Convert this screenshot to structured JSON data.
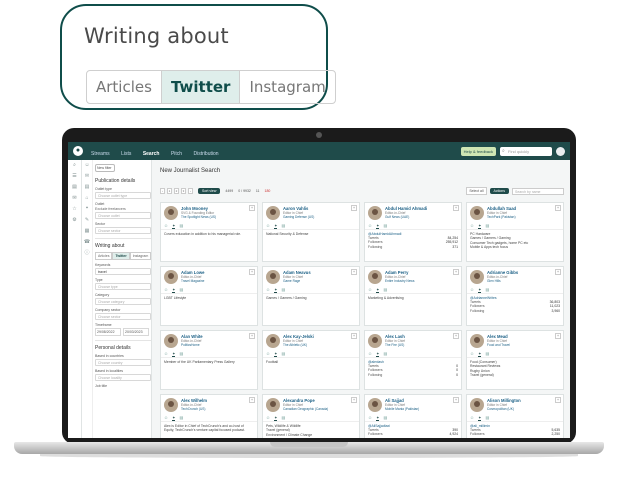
{
  "callout": {
    "title": "Writing about",
    "tabs": [
      {
        "label": "Articles",
        "active": false
      },
      {
        "label": "Twitter",
        "active": true
      },
      {
        "label": "Instagram",
        "active": false
      }
    ]
  },
  "app": {
    "nav": [
      "Streams",
      "Lists",
      "Search",
      "Pitch",
      "Distribution"
    ],
    "nav_active": "Search",
    "help_label": "Help & feedback",
    "search_placeholder": "Find quickly",
    "icon_strip": [
      "⌕",
      "☰",
      "▤",
      "✉",
      "☆",
      "⚙",
      "✎",
      "☎",
      "⓪",
      "ⓘ"
    ]
  },
  "filters": {
    "new_filter": "New filter",
    "publication_heading": "Publication details",
    "outlet_type_label": "Outlet type",
    "outlet_type_placeholder": "Choose outlet type",
    "outlet_label": "Outlet",
    "outlet_exclude": "Exclude freelancers",
    "outlet_placeholder": "Choose outlet",
    "sector_label": "Sector",
    "sector_placeholder": "Choose sector",
    "writing_heading": "Writing about",
    "writing_tabs": [
      "Articles",
      "Twitter",
      "Instagram"
    ],
    "keywords_label": "Keywords",
    "keywords_value": "travel",
    "type_label": "Type",
    "type_placeholder": "Choose type",
    "category_label": "Category",
    "category_placeholder": "Choose category",
    "company_label": "Company sector",
    "company_placeholder": "Choose sector",
    "timeframe_label": "Timeframe",
    "date_from": "29/08/2022",
    "date_to": "20/03/2023",
    "personal_heading": "Personal details",
    "based_countries_label": "Based in countries",
    "based_countries_placeholder": "Choose country",
    "based_localities_label": "Based in localities",
    "based_localities_placeholder": "Choose locality",
    "job_title_label": "Job title"
  },
  "main": {
    "title": "New Journalist Search",
    "pager": [
      "‹",
      "1",
      "2",
      "3",
      "›"
    ],
    "sort_label": "Sort view",
    "stats": [
      "4499",
      "0 / 9932",
      "11",
      "180"
    ],
    "select_all": "Select all",
    "actions": "Actions",
    "search_names_placeholder": "Search by name",
    "cards": [
      {
        "name": "John Mooney",
        "role": "SVG & Founding Editor",
        "org": "The Spotlight News (US)",
        "handle": "",
        "text": "Covers education in addition to his managerial role.",
        "stats": [],
        "extra": ""
      },
      {
        "name": "Aaron Vahlis",
        "role": "Editor in Chief",
        "org": "Gaming Defense (US)",
        "handle": "",
        "text": "National Security & Defense",
        "stats": [],
        "extra": ""
      },
      {
        "name": "Abdul Hamid Ahmadi",
        "role": "Editor-in-Chief",
        "org": "Gulf News (UAE)",
        "handle": "@AbdulHamidAhmadi",
        "text": "",
        "stats": [
          [
            "Tweets",
            "84,254"
          ],
          [
            "Followers",
            "255,912"
          ],
          [
            "Following",
            "371"
          ]
        ],
        "extra": ""
      },
      {
        "name": "Abdullah Saad",
        "role": "Editor in Chief",
        "org": "TechPark (Pakistan)",
        "handle": "",
        "text": "PC Hardware\nGames / Gamers / Gaming\nConsumer Tech gadgets, home PC etc\nMobile & Apps tech focus",
        "stats": [],
        "extra": ""
      },
      {
        "name": "Adam Lowe",
        "role": "Editor-in-Chief",
        "org": "Travel Magazine",
        "handle": "",
        "text": "LGBT Lifestyle",
        "stats": [],
        "extra": ""
      },
      {
        "name": "Adam Neavus",
        "role": "Editor in Chief",
        "org": "Game Rage",
        "handle": "",
        "text": "Games / Gamers / Gaming",
        "stats": [],
        "extra": ""
      },
      {
        "name": "Adam Perry",
        "role": "Editor-in-Chief",
        "org": "Entire Industry News",
        "handle": "",
        "text": "Marketing & Advertising",
        "stats": [],
        "extra": ""
      },
      {
        "name": "Adrianne Gibbs",
        "role": "Editor-in-Chief",
        "org": "Glen Hills",
        "handle": "@AdrianneWrites",
        "text": "",
        "stats": [
          [
            "Tweets",
            "36,803"
          ],
          [
            "Followers",
            "11,023"
          ],
          [
            "Following",
            "3,960"
          ]
        ],
        "extra": ""
      },
      {
        "name": "Alan White",
        "role": "Editor-in-Chief",
        "org": "PoliticsHome",
        "handle": "",
        "text": "Member of the UK Parliamentary Press Gallery",
        "stats": [],
        "extra": ""
      },
      {
        "name": "Alex Kay-Jelski",
        "role": "Editor in Chief",
        "org": "The Athletic (UK)",
        "handle": "",
        "text": "Football",
        "stats": [],
        "extra": ""
      },
      {
        "name": "Alex Lash",
        "role": "Editor in Chief",
        "org": "The Fire (US)",
        "handle": "@alexlash",
        "text": "",
        "stats": [
          [
            "Tweets",
            "0"
          ],
          [
            "Followers",
            "0"
          ],
          [
            "Following",
            "0"
          ]
        ],
        "extra": ""
      },
      {
        "name": "Alex Mead",
        "role": "Editor in Chief",
        "org": "Food and Travel",
        "handle": "",
        "text": "Food (Consumer)\nRestaurant Reviews\nRugby Union\nTravel (general)",
        "stats": [],
        "extra": ""
      },
      {
        "name": "Alex Wilhelm",
        "role": "Editor-in-Chief",
        "org": "TechCrunch (US)",
        "handle": "",
        "text": "Alex is Editor in Chief of TechCrunch's and co-host of Equity, TechCrunch's venture capital focused podcast.",
        "stats": [],
        "extra": ""
      },
      {
        "name": "Alexandra Pope",
        "role": "Editor in Chief",
        "org": "Canadian Geographic (Canada)",
        "handle": "",
        "text": "Pets, Wildlife & Wildlife\nTravel (general)\nEnvironment / Climate Change",
        "stats": [],
        "extra": ""
      },
      {
        "name": "Ali Sajjad",
        "role": "Editor in Chief",
        "org": "Mobile Mania (Pakistan)",
        "handle": "@AliSajjadtaxi",
        "text": "",
        "stats": [
          [
            "Tweets",
            "390"
          ],
          [
            "Followers",
            "4,924"
          ]
        ],
        "extra": ""
      },
      {
        "name": "Alison Millington",
        "role": "Editor in Chief",
        "org": "Cosmopolitan (UK)",
        "handle": "@ali_millimin",
        "text": "",
        "stats": [
          [
            "Tweets",
            "5,635"
          ],
          [
            "Followers",
            "2,250"
          ]
        ],
        "extra": ""
      }
    ]
  }
}
